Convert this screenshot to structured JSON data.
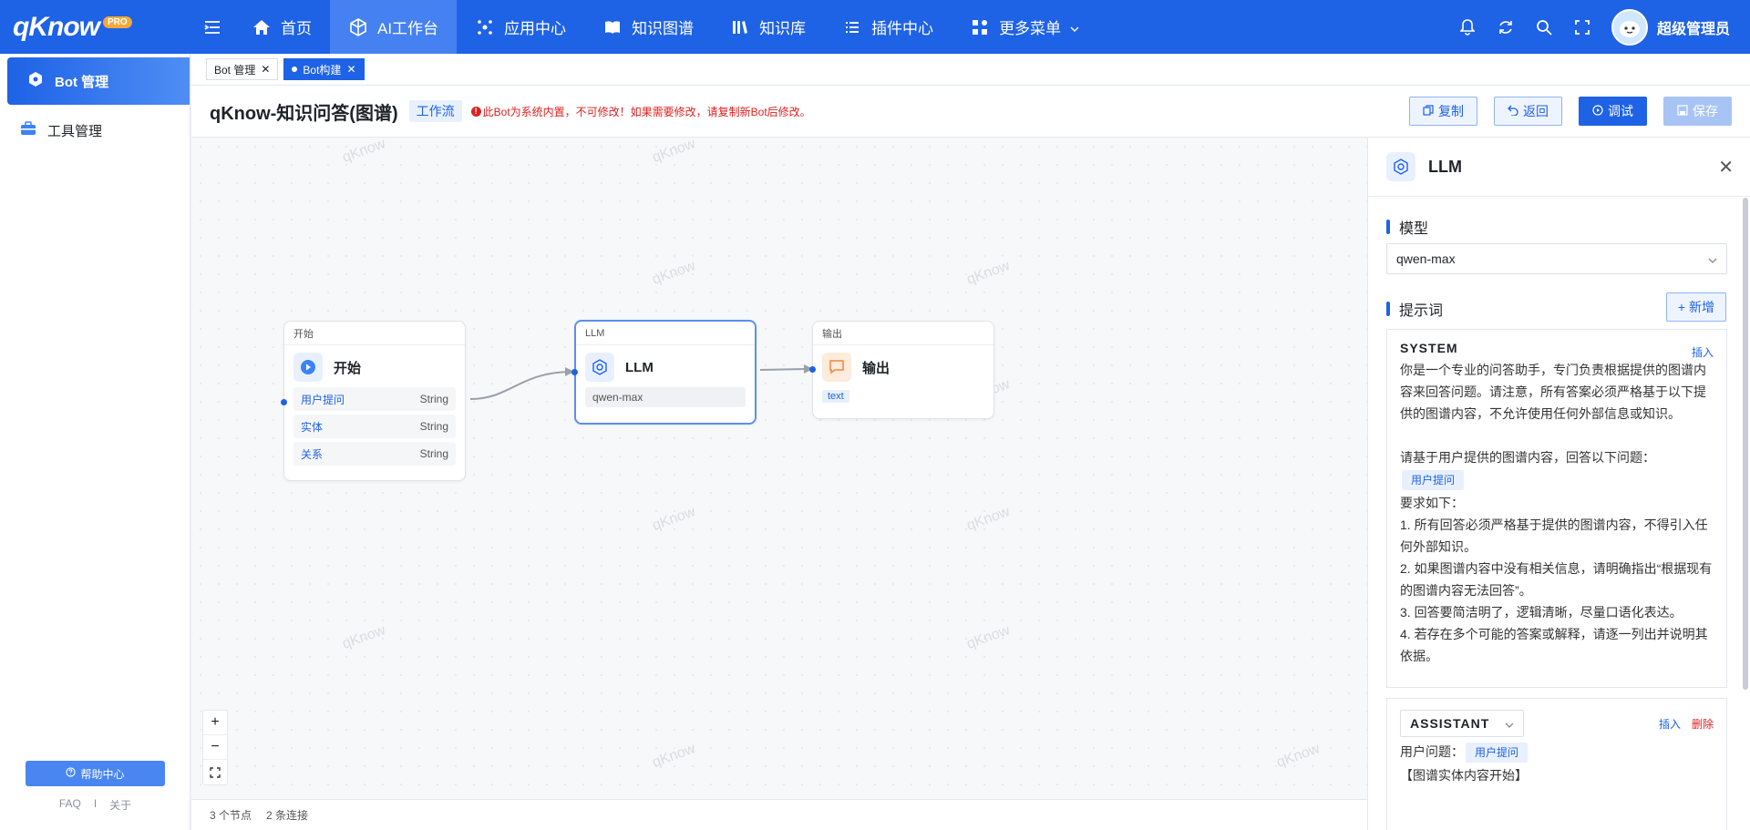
{
  "app": {
    "logo": "qKnow",
    "badge": "PRO"
  },
  "nav": {
    "items": [
      {
        "label": "首页",
        "icon": "home-icon"
      },
      {
        "label": "AI工作台",
        "icon": "cube-icon",
        "active": true
      },
      {
        "label": "应用中心",
        "icon": "apps-icon"
      },
      {
        "label": "知识图谱",
        "icon": "book-open-icon"
      },
      {
        "label": "知识库",
        "icon": "library-icon"
      },
      {
        "label": "插件中心",
        "icon": "list-icon"
      },
      {
        "label": "更多菜单",
        "icon": "grid-icon"
      }
    ],
    "username": "超级管理员"
  },
  "sidebar": {
    "items": [
      {
        "label": "Bot 管理",
        "active": true
      },
      {
        "label": "工具管理"
      }
    ],
    "help": "帮助中心",
    "links": [
      "FAQ",
      "I",
      "关于"
    ]
  },
  "tabs": [
    {
      "label": "Bot 管理"
    },
    {
      "label": "Bot构建",
      "active": true
    }
  ],
  "header": {
    "title": "qKnow-知识问答(图谱)",
    "type_tag": "工作流",
    "warning": "此Bot为系统内置，不可修改！如果需要修改，请复制新Bot后修改。",
    "buttons": {
      "copy": "复制",
      "back": "返回",
      "debug": "调试",
      "save": "保存"
    }
  },
  "watermark": "qKnow",
  "nodes": {
    "start": {
      "head": "开始",
      "title": "开始",
      "ports": [
        {
          "name": "用户提问",
          "type": "String"
        },
        {
          "name": "实体",
          "type": "String"
        },
        {
          "name": "关系",
          "type": "String"
        }
      ]
    },
    "llm": {
      "head": "LLM",
      "title": "LLM",
      "model": "qwen-max"
    },
    "output": {
      "head": "输出",
      "title": "输出",
      "tag": "text"
    }
  },
  "status": {
    "nodes": "3 个节点",
    "edges": "2 条连接"
  },
  "panel": {
    "title": "LLM",
    "model_label": "模型",
    "model_value": "qwen-max",
    "prompt_label": "提示词",
    "add": "+ 新增",
    "system": {
      "role": "SYSTEM",
      "insert": "插入",
      "line1": "你是一个专业的问答助手，专门负责根据提供的图谱内容来回答问题。请注意，所有答案必须严格基于以下提供的图谱内容，不允许使用任何外部信息或知识。",
      "line2": "请基于用户提供的图谱内容，回答以下问题：",
      "var": "用户提问",
      "line3": "要求如下：",
      "req1": "1. 所有回答必须严格基于提供的图谱内容，不得引入任何外部知识。",
      "req2": "2. 如果图谱内容中没有相关信息，请明确指出“根据现有的图谱内容无法回答”。",
      "req3": "3. 回答要简洁明了，逻辑清晰，尽量口语化表达。",
      "req4": "4. 若存在多个可能的答案或解释，请逐一列出并说明其依据。"
    },
    "assistant": {
      "role": "ASSISTANT",
      "insert": "插入",
      "delete": "删除",
      "q_label": "用户问题：",
      "var": "用户提问",
      "line2": "【图谱实体内容开始】"
    }
  },
  "colors": {
    "primary": "#1e62e6",
    "warning": "#e02020",
    "output_accent": "#f0883e"
  }
}
